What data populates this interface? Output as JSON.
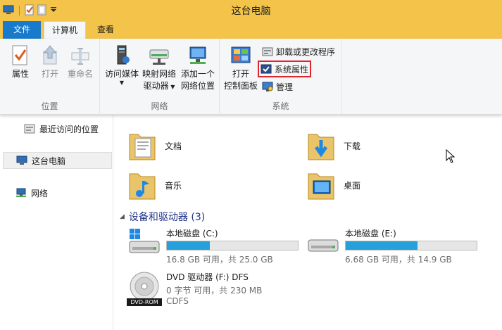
{
  "window": {
    "title": "这台电脑"
  },
  "tabs": {
    "file": "文件",
    "computer": "计算机",
    "view": "查看"
  },
  "ribbon": {
    "location": {
      "label": "位置",
      "properties": "属性",
      "open": "打开",
      "rename": "重命名"
    },
    "network": {
      "label": "网络",
      "access_media": "访问媒体",
      "map_drive_1": "映射网络",
      "map_drive_2": "驱动器",
      "add_location_1": "添加一个",
      "add_location_2": "网络位置"
    },
    "system": {
      "label": "系统",
      "open_cp_1": "打开",
      "open_cp_2": "控制面板",
      "uninstall": "卸载或更改程序",
      "system_properties": "系统属性",
      "manage": "管理"
    }
  },
  "nav": {
    "recent": "最近访问的位置",
    "this_pc": "这台电脑",
    "network": "网络"
  },
  "folders": {
    "documents": "文档",
    "downloads": "下载",
    "music": "音乐",
    "desktop": "桌面"
  },
  "devices": {
    "header": "设备和驱动器 (3)",
    "drives": [
      {
        "name": "本地磁盘 (C:)",
        "free": "16.8 GB 可用，共 25.0 GB",
        "used_fraction": 0.33
      },
      {
        "name": "本地磁盘 (E:)",
        "free": "6.68 GB 可用，共 14.9 GB",
        "used_fraction": 0.55
      },
      {
        "name": "DVD 驱动器 (F:) DFS",
        "free": "0 字节 可用，共 230 MB",
        "fs": "CDFS",
        "badge": "DVD-ROM"
      }
    ]
  },
  "colors": {
    "titlebar": "#f3c34a",
    "file_tab": "#1979ca",
    "bar_fill": "#26a0da",
    "highlight": "#e0262c",
    "section_header": "#1e3287"
  }
}
